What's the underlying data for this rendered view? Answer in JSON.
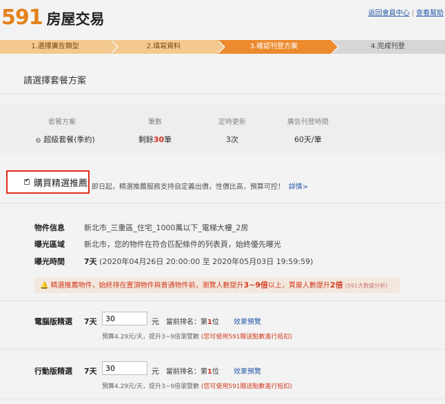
{
  "header": {
    "logo_num": "591",
    "logo_text": "房屋交易",
    "links": [
      "返回會員中心",
      "查看幫助"
    ]
  },
  "steps": [
    {
      "label": "1.選擇廣告類型",
      "state": "done"
    },
    {
      "label": "2.填寫資料",
      "state": "done"
    },
    {
      "label": "3.確認刊登方案",
      "state": "active"
    },
    {
      "label": "4.完成刊登",
      "state": "todo"
    }
  ],
  "section_title": "請選擇套餐方案",
  "plan": {
    "headers": [
      "套餐方案",
      "筆數",
      "定時更新",
      "廣告刊登時間"
    ],
    "name": "超級套餐(季約)",
    "count_prefix": "剩餘",
    "count_num": "30",
    "count_suffix": "筆",
    "refresh": "3次",
    "duration": "60天/筆"
  },
  "featured": {
    "label": "購買精選推薦",
    "desc": "即日起，精選推薦服務支持自定義出價，性價比高，預算可控！",
    "more": "詳情>"
  },
  "info": {
    "item_label": "物件信息",
    "item_value": "新北市_三重區_住宅_1000萬以下_電梯大樓_2房",
    "area_label": "曝光區域",
    "area_value": "新北市，您的物件在符合匹配條件的列表頁，始終優先曝光",
    "time_label": "曝光時間",
    "time_days": "7天",
    "time_range": "(2020年04月26日 20:00:00 至 2020年05月03日 19:59:59)"
  },
  "notice": {
    "icon": "bell-icon",
    "p1": "精選推薦物件，始終排在置頂物件與普通物件前，瀏覽人數提升",
    "b1": "3~9倍",
    "p2": "以上，買屋人數提升",
    "b2": "2倍",
    "small": "(591大數據分析)"
  },
  "ads": [
    {
      "label": "電腦版精選",
      "days": "7天",
      "value": "30",
      "unit": "元",
      "rank_prefix": "當前排名：第",
      "rank": "1",
      "rank_suffix": "位",
      "preview": "效果預覽",
      "note": "預算4.29元/天，提升3~9倍瀏覽數",
      "note_red": "(您可使用591贈送點數進行抵扣)"
    },
    {
      "label": "行動版精選",
      "days": "7天",
      "value": "30",
      "unit": "元",
      "rank_prefix": "當前排名：第",
      "rank": "1",
      "rank_suffix": "位",
      "preview": "效果預覽",
      "note": "預算4.29元/天，提升3~9倍瀏覽數",
      "note_red": "(您可使用591贈送點數進行抵扣)"
    }
  ]
}
